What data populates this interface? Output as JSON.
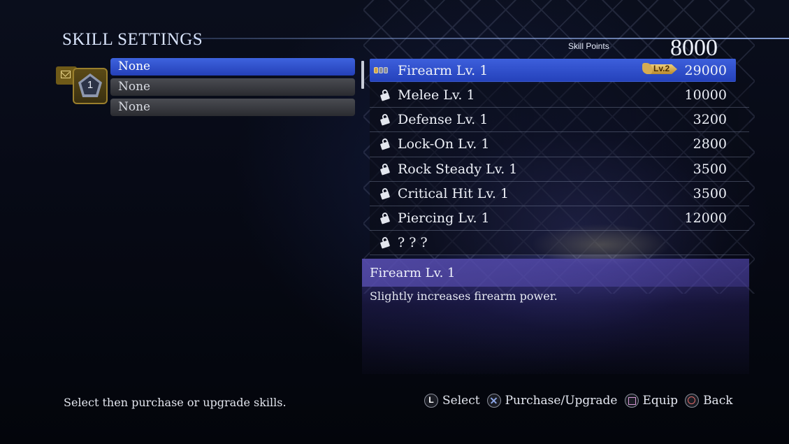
{
  "header": {
    "title": "SKILL SETTINGS",
    "skill_points_label": "Skill Points",
    "skill_points_value": "8000"
  },
  "slot": {
    "number": "1"
  },
  "equipped": [
    {
      "label": "None",
      "selected": true
    },
    {
      "label": "None",
      "selected": false
    },
    {
      "label": "None",
      "selected": false
    }
  ],
  "skills": [
    {
      "name": "Firearm Lv. 1",
      "cost": "29000",
      "badge": "Lv.2",
      "selected": true,
      "icon": "progress-dots-icon"
    },
    {
      "name": "Melee Lv. 1",
      "cost": "10000",
      "icon": "lock-icon"
    },
    {
      "name": "Defense Lv. 1",
      "cost": "3200",
      "icon": "lock-icon"
    },
    {
      "name": "Lock-On Lv. 1",
      "cost": "2800",
      "icon": "lock-icon"
    },
    {
      "name": "Rock Steady Lv. 1",
      "cost": "3500",
      "icon": "lock-icon"
    },
    {
      "name": "Critical Hit Lv. 1",
      "cost": "3500",
      "icon": "lock-icon"
    },
    {
      "name": "Piercing Lv. 1",
      "cost": "12000",
      "icon": "lock-icon"
    },
    {
      "name": "? ? ?",
      "cost": "",
      "icon": "lock-icon"
    }
  ],
  "description": {
    "title": "Firearm Lv. 1",
    "text": "Slightly increases firearm power."
  },
  "footer": {
    "hint": "Select then purchase or upgrade skills.",
    "controls": [
      {
        "button": "L",
        "label": "Select"
      },
      {
        "button": "cross",
        "label": "Purchase/Upgrade"
      },
      {
        "button": "square",
        "label": "Equip"
      },
      {
        "button": "circle",
        "label": "Back"
      }
    ]
  }
}
